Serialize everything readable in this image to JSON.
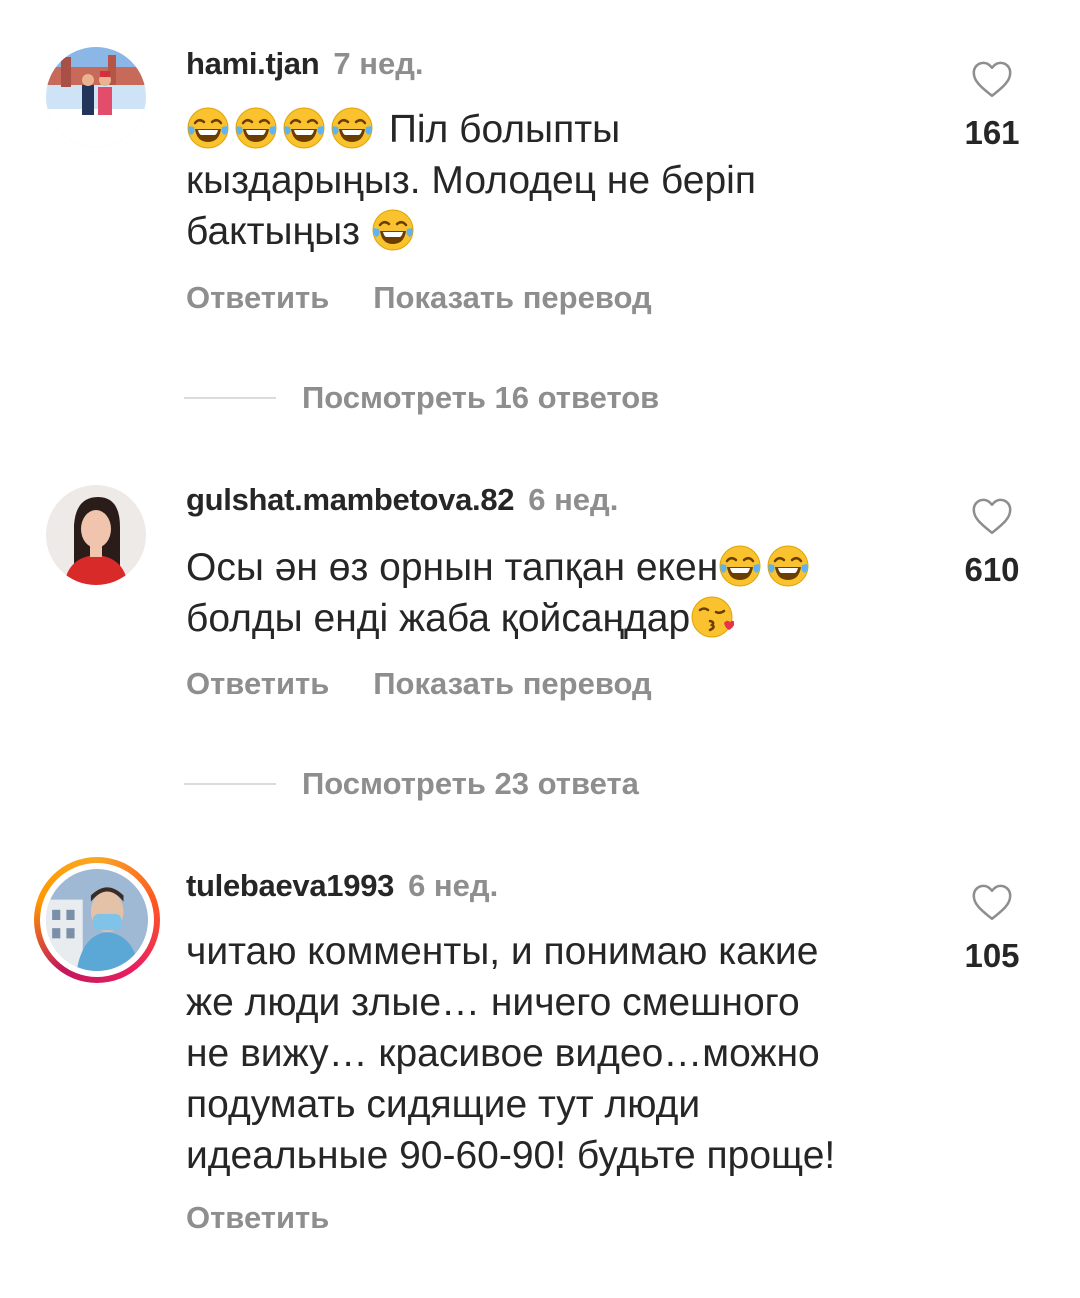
{
  "comments": [
    {
      "username": "hami.tjan",
      "time": "7 нед.",
      "text_parts": [
        "Піл болыпты",
        "кыздарыңыз. Молодец не беріп",
        "бактыңыз"
      ],
      "likes": "161",
      "reply_label": "Ответить",
      "translate_label": "Показать перевод",
      "view_replies": "Посмотреть 16 ответов"
    },
    {
      "username": "gulshat.mambetova.82",
      "time": "6 нед.",
      "text_parts": [
        "Осы ән өз орнын тапқан екен",
        "болды енді жаба қойсаңдар"
      ],
      "likes": "610",
      "reply_label": "Ответить",
      "translate_label": "Показать перевод",
      "view_replies": "Посмотреть 23 ответа"
    },
    {
      "username": "tulebaeva1993",
      "time": "6 нед.",
      "text_lines": [
        "читаю комменты, и понимаю какие",
        "же люди злые… ничего смешного",
        "не вижу… красивое видео…можно",
        "подумать сидящие тут люди",
        "идеальные 90-60-90! будьте проще!"
      ],
      "likes": "105",
      "reply_label": "Ответить"
    }
  ],
  "icons": {
    "like": "heart-outline-icon",
    "emoji_laugh": "face-with-tears-of-joy-icon",
    "emoji_kiss": "face-blowing-kiss-icon"
  },
  "colors": {
    "text": "#262626",
    "secondary": "#8e8e8e",
    "divider": "#dbdbdb",
    "emoji_yellow": "#f9c22e"
  }
}
